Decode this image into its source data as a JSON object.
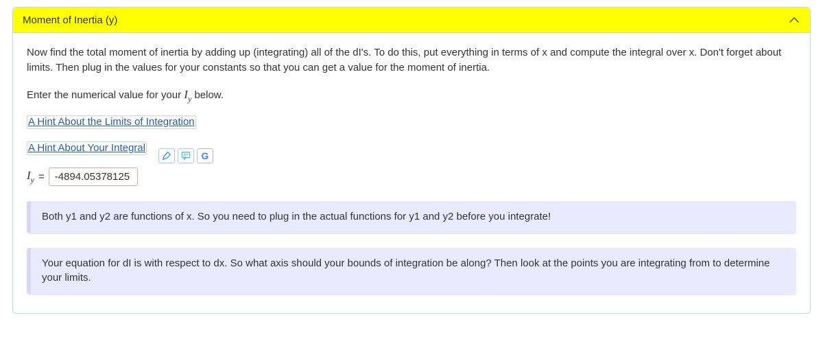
{
  "panel": {
    "title": "Moment of Inertia (y)"
  },
  "body": {
    "intro": "Now find the total moment of inertia by adding up (integrating) all of the dI's. To do this, put everything in terms of x and compute the integral over x. Don't forget about limits. Then plug in the values for your constants so that you can get a value for the moment of inertia.",
    "enter_prefix": "Enter the numerical value for your ",
    "enter_suffix": " below.",
    "hint1": "A Hint About the Limits of Integration",
    "hint2": "A Hint About Your Integral",
    "equals": " = ",
    "value": "-4894.05378125"
  },
  "feedback": {
    "f1": "Both y1 and y2 are functions of x. So you need to plug in the actual functions for y1 and y2 before you integrate!",
    "f2": "Your equation for dI is with respect to dx. So what axis should your bounds of integration be along? Then look at the points you are integrating from to determine your limits."
  }
}
